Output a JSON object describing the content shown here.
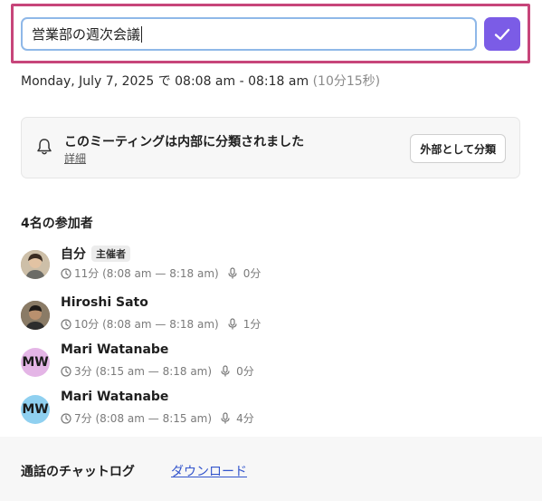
{
  "meeting": {
    "title_value": "営業部の週次会議",
    "date": "Monday, July 7, 2025",
    "date_particle": "で",
    "time_range": "08:08 am - 08:18 am",
    "duration": "(10分15秒)"
  },
  "classification": {
    "message": "このミーティングは内部に分類されました",
    "details_link": "詳細",
    "classify_button": "外部として分類"
  },
  "participants": {
    "heading": "4名の参加者",
    "items": [
      {
        "name": "自分",
        "badge": "主催者",
        "time": "11分 (8:08 am — 8:18 am)",
        "talk": "0分",
        "avatar_type": "photo-1"
      },
      {
        "name": "Hiroshi Sato",
        "time": "10分 (8:08 am — 8:18 am)",
        "talk": "1分",
        "avatar_type": "photo-2"
      },
      {
        "name": "Mari Watanabe",
        "initials": "MW",
        "avatar_color": "#e4b5e6",
        "time": "3分 (8:15 am — 8:18 am)",
        "talk": "0分"
      },
      {
        "name": "Mari Watanabe",
        "initials": "MW",
        "avatar_color": "#8fd0f0",
        "time": "7分 (8:08 am — 8:15 am)",
        "talk": "4分"
      }
    ]
  },
  "chat_log": {
    "label": "通話のチャットログ",
    "download_link": "ダウンロード"
  },
  "colors": {
    "accent": "#7b5ce6",
    "highlight_frame": "#c7457a",
    "input_border": "#8fb8e8",
    "link": "#3355cc"
  },
  "icons": [
    "check-icon",
    "bell-icon",
    "clock-icon",
    "microphone-icon"
  ]
}
